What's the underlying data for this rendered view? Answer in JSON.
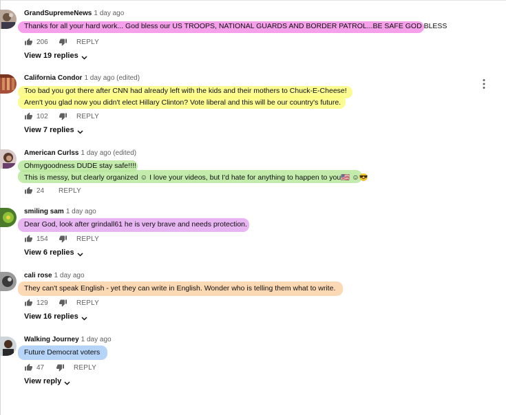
{
  "comments": [
    {
      "author": "GrandSupremeNews",
      "time": "1 day ago",
      "lines": [
        "Thanks for all your hard work... God bless our US TROOPS, NATIONAL GUARDS AND BORDER PATROL...BE SAFE GOD BLESS"
      ],
      "likes": "206",
      "reply_label": "REPLY",
      "view_replies": "View 19 replies",
      "highlight_color": "#f58ee6"
    },
    {
      "author": "California Condor",
      "time": "1 day ago (edited)",
      "lines": [
        "Too bad you got there after CNN had already left with the kids and their mothers to Chuck-E-Cheese!",
        "Aren't you glad now you didn't elect Hillary Clinton? Vote liberal and this will be our country's future."
      ],
      "likes": "102",
      "reply_label": "REPLY",
      "view_replies": "View 7 replies",
      "highlight_color": "#fafa7e"
    },
    {
      "author": "American Curlss",
      "time": "1 day ago (edited)",
      "lines": [
        "Ohmygoodness DUDE stay safe!!!!",
        "This is messy, but clearly organized ☺ I love your videos, but I'd hate for anything to happen to you🇺🇸 ☺😎"
      ],
      "likes": "24",
      "reply_label": "REPLY",
      "view_replies": "",
      "highlight_color": "#b9e79e"
    },
    {
      "author": "smiling sam",
      "time": "1 day ago",
      "lines": [
        "Dear God, look after grindall61 he is very brave and needs protection."
      ],
      "likes": "154",
      "reply_label": "REPLY",
      "view_replies": "View 6 replies",
      "highlight_color": "#e3a8f0"
    },
    {
      "author": "cali rose",
      "time": "1 day ago",
      "lines": [
        "They can't speak English - yet they can write in English. Wonder who is telling them what to write."
      ],
      "likes": "129",
      "reply_label": "REPLY",
      "view_replies": "View 16 replies",
      "highlight_color": "#fbd2a8"
    },
    {
      "author": "Walking Journey",
      "time": "1 day ago",
      "lines": [
        "Future Democrat voters"
      ],
      "likes": "47",
      "reply_label": "REPLY",
      "view_replies": "View reply",
      "highlight_color": "#a9cdf7"
    }
  ],
  "icons": {
    "like": "thumb-up-icon",
    "dislike": "thumb-down-icon",
    "more": "more-vert-icon",
    "chevron": "chevron-down-icon"
  }
}
